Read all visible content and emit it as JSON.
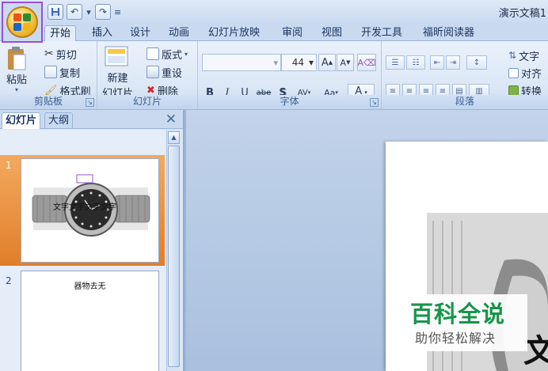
{
  "window": {
    "title": "演示文稿1"
  },
  "tabs": [
    "开始",
    "插入",
    "设计",
    "动画",
    "幻灯片放映",
    "审阅",
    "视图",
    "开发工具",
    "福昕阅读器"
  ],
  "ribbon": {
    "clipboard": {
      "label": "剪贴板",
      "paste": "粘贴",
      "cut": "剪切",
      "copy": "复制",
      "format_painter": "格式刷"
    },
    "slides": {
      "label": "幻灯片",
      "new_slide_line1": "新建",
      "new_slide_line2": "幻灯片",
      "layout": "版式",
      "reset": "重设",
      "delete": "删除"
    },
    "font": {
      "label": "字体",
      "font_size": "44",
      "bold": "B",
      "italic": "I",
      "underline": "U",
      "strike": "abe",
      "shadow": "S",
      "spacing": "AV",
      "case": "Aa",
      "color": "A",
      "grow": "A",
      "shrink": "A"
    },
    "paragraph": {
      "label": "段落",
      "text_direction": "文字",
      "align_text": "对齐",
      "convert": "转换"
    }
  },
  "pane": {
    "tabs": [
      "幻灯片",
      "大纲"
    ],
    "slides": [
      {
        "num": "1",
        "text": "文字文字文字文字"
      },
      {
        "num": "2",
        "text": "器物去无"
      }
    ]
  },
  "watermark": {
    "title": "百科全说",
    "subtitle": "助你轻松解决",
    "main_char": "文"
  }
}
